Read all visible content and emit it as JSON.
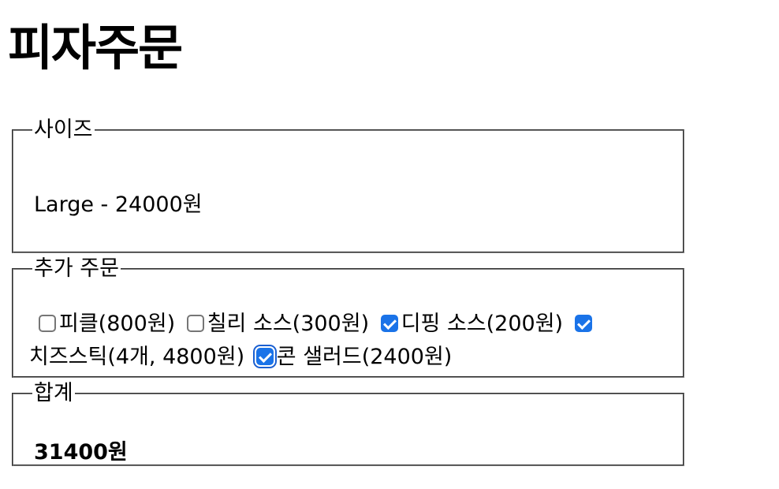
{
  "page": {
    "title": "피자주문"
  },
  "size_section": {
    "legend": "사이즈",
    "selected_text": "Large - 24000원"
  },
  "extras_section": {
    "legend": "추가 주문",
    "options": [
      {
        "label": "피클(800원)",
        "checked": false
      },
      {
        "label": "칠리 소스(300원)",
        "checked": false
      },
      {
        "label": "디핑 소스(200원)",
        "checked": true
      },
      {
        "label": "치즈스틱(4개, 4800원)",
        "checked": true
      },
      {
        "label": "콘 샐러드(2400원)",
        "checked": true,
        "focused": true
      }
    ]
  },
  "total_section": {
    "legend": "합계",
    "value": "31400원"
  },
  "colors": {
    "checkbox_checked": "#1a73e8",
    "fieldset_border": "#7f7f7f"
  }
}
